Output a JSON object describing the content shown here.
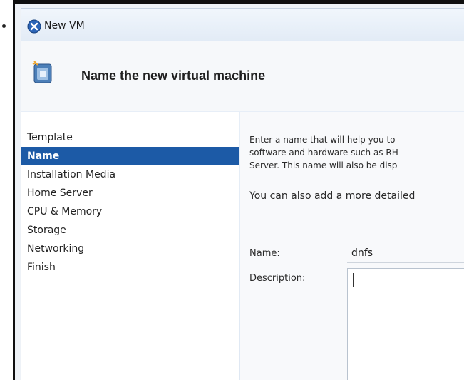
{
  "window": {
    "title": "New VM"
  },
  "header": {
    "title": "Name the new virtual machine"
  },
  "nav": {
    "items": [
      {
        "label": "Template",
        "selected": false
      },
      {
        "label": "Name",
        "selected": true
      },
      {
        "label": "Installation Media",
        "selected": false
      },
      {
        "label": "Home Server",
        "selected": false
      },
      {
        "label": "CPU & Memory",
        "selected": false
      },
      {
        "label": "Storage",
        "selected": false
      },
      {
        "label": "Networking",
        "selected": false
      },
      {
        "label": "Finish",
        "selected": false
      }
    ]
  },
  "content": {
    "description_lines": [
      "Enter a name that will help you to",
      "software and hardware such as RH",
      "Server. This name will also be disp"
    ],
    "description_more": "You can also add a more detailed",
    "name_label": "Name:",
    "name_value": "dnfs",
    "description_label": "Description:",
    "description_value": ""
  },
  "colors": {
    "selected_bg": "#1c5aa6",
    "selected_text": "#ffffff"
  }
}
